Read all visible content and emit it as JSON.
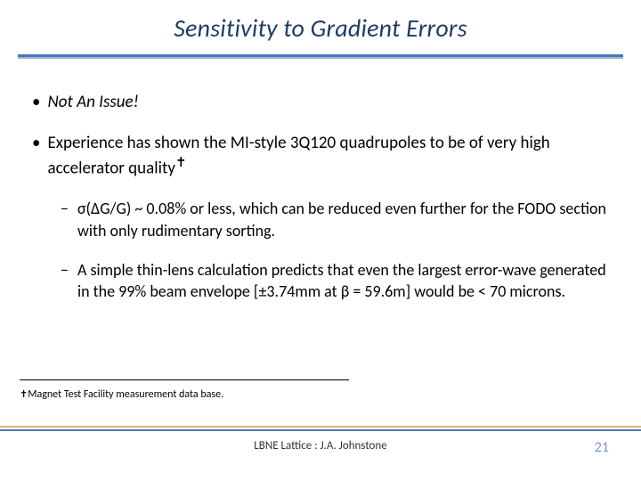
{
  "title": "Sensitivity to Gradient Errors",
  "bullets": {
    "b1": {
      "marker": "•",
      "text": "Not An Issue!"
    },
    "b2": {
      "marker": "•",
      "text_pre": "Experience has shown the MI-style 3Q120 quadrupoles to be of very high accelerator quality",
      "dagger": "✝"
    },
    "sub1": {
      "marker": "−",
      "sigma": "σ",
      "delta": "Δ",
      "text_rest": "G/G) ~ 0.08% or less, which can be reduced even further for the FODO section with only rudimentary sorting."
    },
    "sub2": {
      "marker": "−",
      "pm": "±",
      "beta": "β",
      "text_a": "A simple thin-lens calculation predicts that even the largest error-wave generated in the 99% beam envelope [",
      "text_mid": "3.74mm at ",
      "text_eq": " = 59.6m] would be < 70 microns."
    }
  },
  "footnote": {
    "dagger": "✝",
    "text": "Magnet Test Facility measurement data base."
  },
  "footer": {
    "center": "LBNE Lattice : J.A. Johnstone",
    "page": "21"
  }
}
